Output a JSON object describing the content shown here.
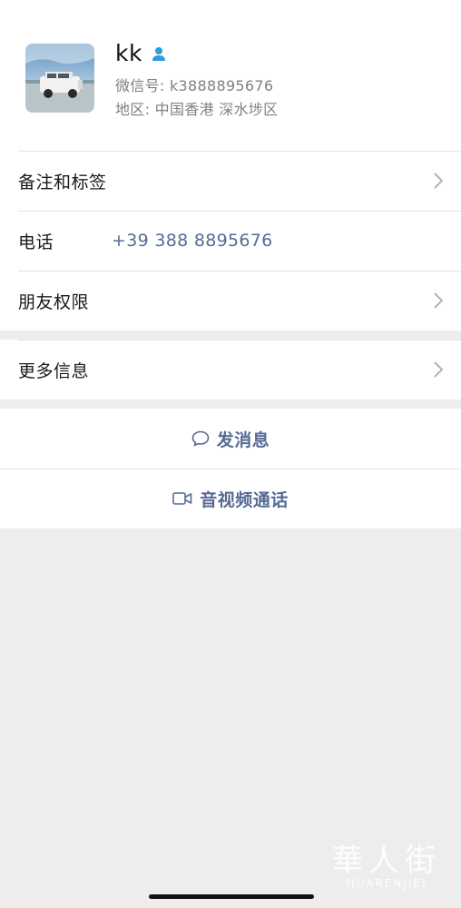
{
  "profile": {
    "name": "kk",
    "wechat_id": "微信号: k3888895676",
    "region": "地区: 中国香港 深水埗区",
    "badge_icon": "person-icon"
  },
  "rows": {
    "remarks_label": "备注和标签",
    "phone_label": "电话",
    "phone_value": "+39 388 8895676",
    "friend_permission_label": "朋友权限",
    "more_info_label": "更多信息"
  },
  "actions": {
    "message_label": "发消息",
    "video_call_label": "音视频通话"
  },
  "watermark": {
    "logo": "華人街",
    "text": "HUARENJIEI"
  },
  "colors": {
    "link": "#576b95",
    "background": "#ededed",
    "badge": "#2f9ae0"
  }
}
